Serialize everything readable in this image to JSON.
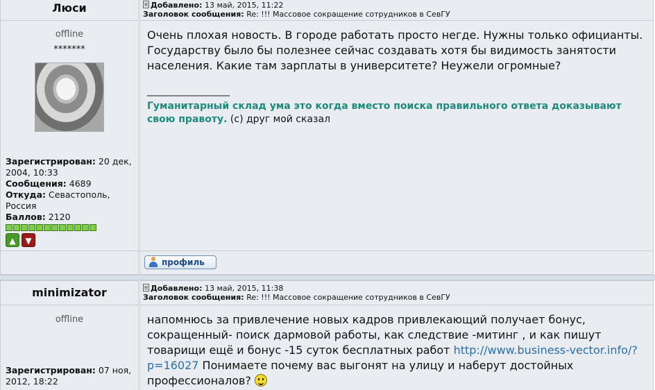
{
  "posts": [
    {
      "author": "Люси",
      "added_label": "Добавлено:",
      "added_date": "13 май, 2015, 11:22",
      "subject_label": "Заголовок сообщения:",
      "subject": "Re: !!! Массовое сокращение сотрудников в СевГУ",
      "status": "offline",
      "rank_stars": "*******",
      "reg_label": "Зарегистрирован:",
      "reg_value": "20 дек, 2004, 10:33",
      "posts_label": "Сообщения:",
      "posts_value": "4689",
      "from_label": "Откуда:",
      "from_value": "Севастополь, Россия",
      "points_label": "Баллов:",
      "points_value": "2120",
      "body": "Очень плохая новость. В городе работать просто негде. Нужны только официанты. Государству было бы полезнее сейчас создавать хотя бы видимость занятости населения. Какие там зарплаты в университете? Неужели огромные?",
      "sig_line": "_________________",
      "sig_bold": "Гуманитарный склад ума это когда вместо поиска правильного ответа доказывают свою правоту.",
      "sig_rest": " (с) друг мой сказал",
      "profile_button": "профиль"
    },
    {
      "author": "minimizator",
      "added_label": "Добавлено:",
      "added_date": "13 май, 2015, 11:38",
      "subject_label": "Заголовок сообщения:",
      "subject": "Re: !!! Массовое сокращение сотрудников в СевГУ",
      "status": "offline",
      "reg_label": "Зарегистрирован:",
      "reg_value": "07 ноя, 2012, 18:22",
      "body_part1": "напомнюсь за привлечение новых кадров привлекающий получает бонус, сокращенный- поиск дармовой работы, как следствие -митинг , и как пишут товарищи ещё и бонус -15 суток бесплатных работ ",
      "body_link": "http://www.business-vector.info/?p=16027",
      "body_part2": " Понимаете почему вас выгонят на улицу и наберут достойных профессионалов? "
    }
  ],
  "icons": {
    "note": "post-note-icon",
    "avatar": "user-avatar",
    "thumb_up": "thumb-up-icon",
    "thumb_down": "thumb-down-icon",
    "profile": "profile-user-icon",
    "smiley": "smiley-icon"
  },
  "colors": {
    "cell_bg": "#e9edf1",
    "border": "#c5ccd4",
    "signature": "#1d8a7c",
    "link": "#2a6fa8"
  }
}
